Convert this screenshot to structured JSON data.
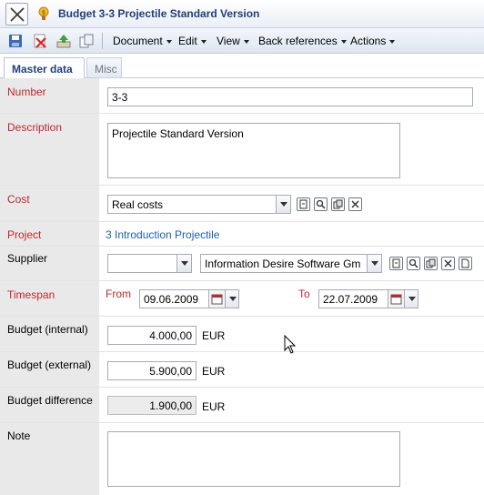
{
  "window": {
    "title": "Budget 3-3 Projectile Standard Version"
  },
  "toolbar": {
    "icons": [
      "save-icon",
      "delete-icon",
      "upload-icon",
      "copy-icon"
    ],
    "menus": [
      {
        "label": "Document"
      },
      {
        "label": "Edit"
      },
      {
        "label": "View"
      },
      {
        "label": "Back references"
      },
      {
        "label": "Actions"
      }
    ]
  },
  "tabs": [
    {
      "label": "Master data",
      "active": true
    },
    {
      "label": "Misc",
      "active": false
    }
  ],
  "form": {
    "number": {
      "label": "Number",
      "value": "3-3"
    },
    "description": {
      "label": "Description",
      "value": "Projectile Standard Version"
    },
    "cost": {
      "label": "Cost",
      "value": "Real costs"
    },
    "project": {
      "label": "Project",
      "value": "3 Introduction Projectile"
    },
    "supplier": {
      "label": "Supplier",
      "type_value": "",
      "value": "Information Desire Software Gm"
    },
    "timespan": {
      "label": "Timespan",
      "from_label": "From",
      "from": "09.06.2009",
      "to_label": "To",
      "to": "22.07.2009"
    },
    "budget_internal": {
      "label": "Budget (internal)",
      "value": "4.000,00",
      "unit": "EUR"
    },
    "budget_external": {
      "label": "Budget (external)",
      "value": "5.900,00",
      "unit": "EUR"
    },
    "budget_difference": {
      "label": "Budget difference",
      "value": "1.900,00",
      "unit": "EUR"
    },
    "note": {
      "label": "Note",
      "value": ""
    }
  },
  "colors": {
    "required_label": "#c0272d",
    "link": "#1b5fb4",
    "title": "#1f3f7a"
  }
}
